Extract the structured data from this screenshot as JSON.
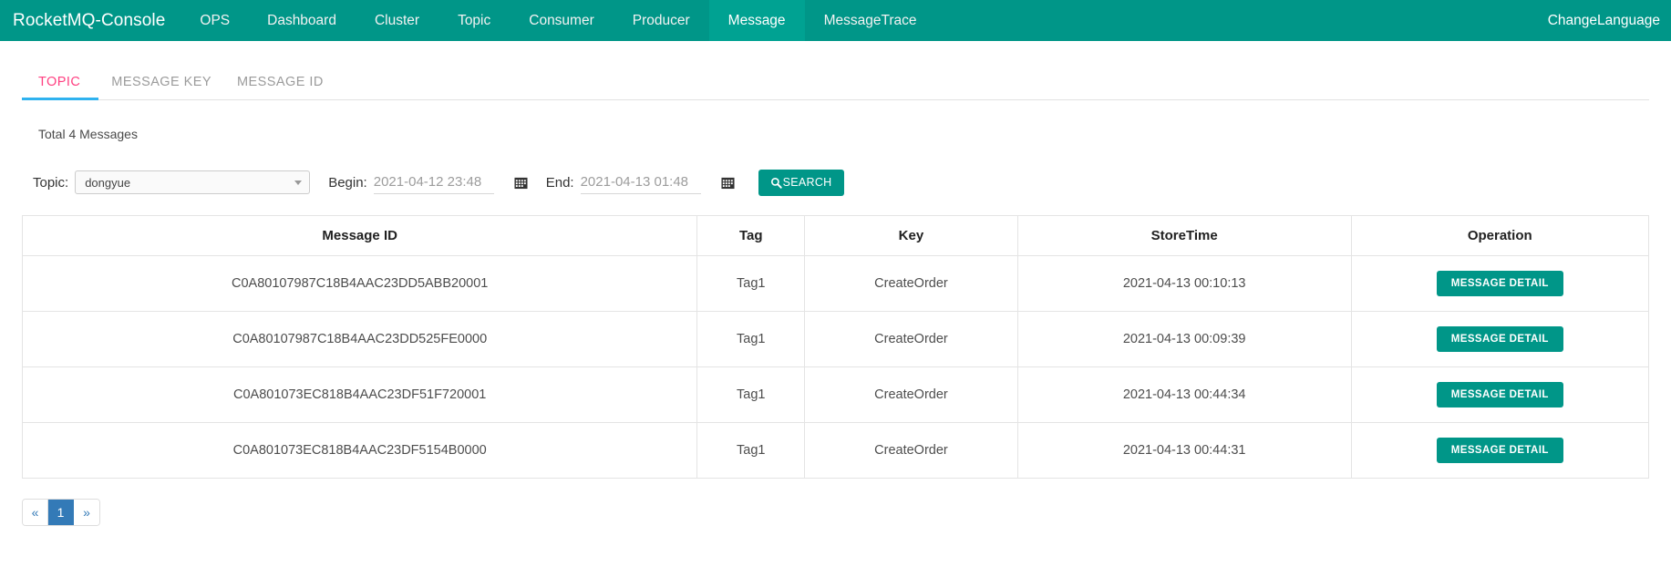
{
  "navbar": {
    "brand": "RocketMQ-Console",
    "items": [
      {
        "label": "OPS",
        "active": false
      },
      {
        "label": "Dashboard",
        "active": false
      },
      {
        "label": "Cluster",
        "active": false
      },
      {
        "label": "Topic",
        "active": false
      },
      {
        "label": "Consumer",
        "active": false
      },
      {
        "label": "Producer",
        "active": false
      },
      {
        "label": "Message",
        "active": true
      },
      {
        "label": "MessageTrace",
        "active": false
      }
    ],
    "change_language": "ChangeLanguage",
    "bg_color": "#009688",
    "active_bg_color": "#00a292"
  },
  "tabs": [
    {
      "label": "TOPIC",
      "active": true
    },
    {
      "label": "MESSAGE KEY",
      "active": false
    },
    {
      "label": "MESSAGE ID",
      "active": false
    }
  ],
  "tab_active_color": "#ff4081",
  "tab_underline_color": "#2fb2ef",
  "summary": "Total 4 Messages",
  "filters": {
    "topic_label": "Topic:",
    "topic_value": "dongyue",
    "begin_label": "Begin:",
    "begin_value": "2021-04-12 23:48",
    "end_label": "End:",
    "end_value": "2021-04-13 01:48",
    "search_label": "SEARCH"
  },
  "table": {
    "columns": [
      "Message ID",
      "Tag",
      "Key",
      "StoreTime",
      "Operation"
    ],
    "action_label": "MESSAGE DETAIL",
    "rows": [
      {
        "message_id": "C0A80107987C18B4AAC23DD5ABB20001",
        "tag": "Tag1",
        "key": "CreateOrder",
        "store_time": "2021-04-13 00:10:13"
      },
      {
        "message_id": "C0A80107987C18B4AAC23DD525FE0000",
        "tag": "Tag1",
        "key": "CreateOrder",
        "store_time": "2021-04-13 00:09:39"
      },
      {
        "message_id": "C0A801073EC818B4AAC23DF51F720001",
        "tag": "Tag1",
        "key": "CreateOrder",
        "store_time": "2021-04-13 00:44:34"
      },
      {
        "message_id": "C0A801073EC818B4AAC23DF5154B0000",
        "tag": "Tag1",
        "key": "CreateOrder",
        "store_time": "2021-04-13 00:44:31"
      }
    ]
  },
  "pagination": {
    "prev": "«",
    "next": "»",
    "pages": [
      "1"
    ],
    "current": "1",
    "active_color": "#337ab7"
  }
}
